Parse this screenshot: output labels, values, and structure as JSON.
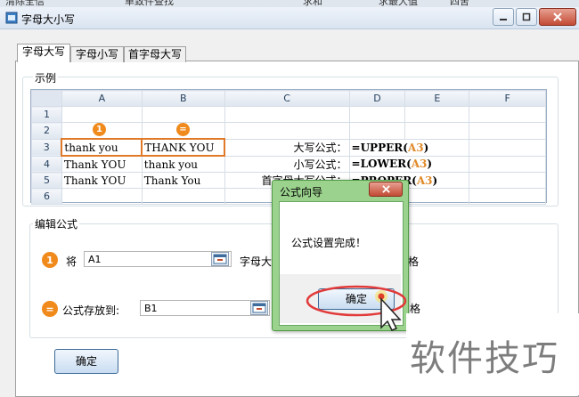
{
  "taskbar": {
    "items": [
      "清除全信",
      "单致件查找",
      "求和",
      "求最大值",
      "四舍"
    ]
  },
  "window": {
    "title": "字母大小写"
  },
  "tabs": [
    "字母大写",
    "字母小写",
    "首字母大写"
  ],
  "example": {
    "group_title": "示例",
    "columns": [
      "A",
      "B",
      "C",
      "D",
      "E",
      "F"
    ],
    "rows": [
      "1",
      "2",
      "3",
      "4",
      "5",
      "6"
    ],
    "badge_a": "1",
    "badge_b": "=",
    "cells": {
      "a3": "thank you",
      "b3": "THANK YOU",
      "a4": "Thank YOU",
      "b4": "thank you",
      "a5": "Thank YOU",
      "b5": "Thank You"
    },
    "labels": {
      "upper": "大写公式：",
      "lower": "小写公式：",
      "proper": "首字母大写公式："
    },
    "formulas": {
      "upper_fn": "=UPPER(",
      "upper_ref": "A3",
      "upper_close": ")",
      "lower_fn": "=LOWER(",
      "lower_ref": "A3",
      "lower_close": ")",
      "proper_fn": "=PROPER(",
      "proper_ref": "A3",
      "proper_close": ")"
    }
  },
  "edit": {
    "group_title": "编辑公式",
    "step1_badge": "1",
    "step1_label": "将",
    "source_value": "A1",
    "step1_suffix": "字母大",
    "step1_tail": "格",
    "step2_badge": "=",
    "target_label": "公式存放到:",
    "target_value": "B1",
    "step2_tail": "格"
  },
  "confirm_label": "确定",
  "dialog": {
    "title": "公式向导",
    "message": "公式设置完成！",
    "ok_label": "确定"
  },
  "watermark": "软件技巧",
  "colors": {
    "accent": "#f08a1c",
    "dialog_frame": "#9bd28d",
    "button": "#c9ddf1"
  }
}
